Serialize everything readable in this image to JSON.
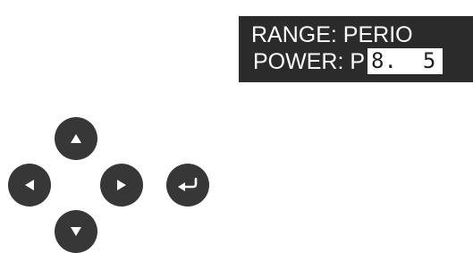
{
  "display": {
    "range_label": "RANGE: PERIO",
    "power_label": "POWER: P",
    "power_value": "8.  5"
  },
  "keypad": {
    "up_icon": "triangle-up-icon",
    "left_icon": "triangle-left-icon",
    "right_icon": "triangle-right-icon",
    "down_icon": "triangle-down-icon",
    "enter_icon": "enter-return-icon"
  },
  "colors": {
    "lcd_background": "#2b2b2b",
    "lcd_text": "#ffffff",
    "value_highlight": "#ffffff",
    "button": "#373737",
    "button_glyph": "#ffffff"
  }
}
